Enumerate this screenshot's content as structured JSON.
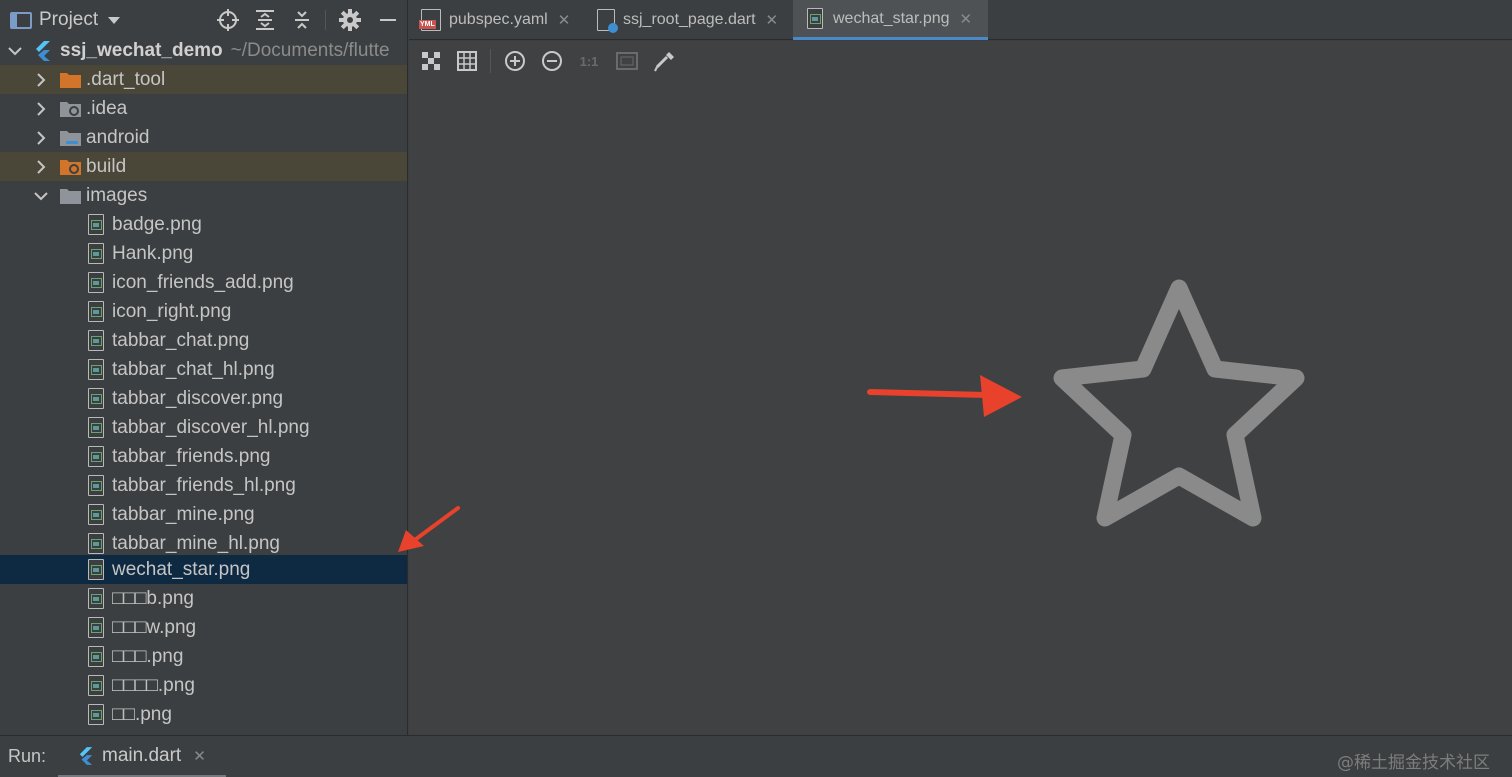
{
  "project_panel": {
    "title": "Project",
    "tools": [
      "locate-icon",
      "expand-all-icon",
      "collapse-all-icon",
      "gear-icon",
      "minimize-icon"
    ]
  },
  "tree": {
    "root": {
      "name": "ssj_wechat_demo",
      "path": "~/Documents/flutte"
    },
    "folders": [
      {
        "name": ".dart_tool",
        "expanded": false,
        "highlight": true
      },
      {
        "name": ".idea",
        "expanded": false,
        "highlight": false
      },
      {
        "name": "android",
        "expanded": false,
        "highlight": false
      },
      {
        "name": "build",
        "expanded": false,
        "highlight": true
      },
      {
        "name": "images",
        "expanded": true,
        "highlight": false
      }
    ],
    "images": [
      "badge.png",
      "Hank.png",
      "icon_friends_add.png",
      "icon_right.png",
      "tabbar_chat.png",
      "tabbar_chat_hl.png",
      "tabbar_discover.png",
      "tabbar_discover_hl.png",
      "tabbar_friends.png",
      "tabbar_friends_hl.png",
      "tabbar_mine.png",
      "tabbar_mine_hl.png",
      "wechat_star.png",
      "□□□b.png",
      "□□□w.png",
      "□□□.png",
      "□□□□.png",
      "□□.png"
    ],
    "selected": "wechat_star.png"
  },
  "tabs": [
    {
      "label": "pubspec.yaml",
      "icon": "yaml-file-icon",
      "yml_badge": "YML"
    },
    {
      "label": "ssj_root_page.dart",
      "icon": "dart-file-icon"
    },
    {
      "label": "wechat_star.png",
      "icon": "image-file-icon",
      "active": true
    }
  ],
  "image_toolbar": {
    "tools": [
      "chessboard-icon",
      "grid-icon",
      "zoom-in-icon",
      "zoom-out-icon",
      "actual-size-icon",
      "fit-zoom-icon",
      "color-picker-icon"
    ],
    "actual_size_label": "1:1"
  },
  "bottom": {
    "run_label": "Run:",
    "run_tab": "main.dart",
    "watermark": "@稀土掘金技术社区"
  },
  "colors": {
    "accent": "#4a88c7",
    "arrow": "#e8412c",
    "star": "#8a8a8a",
    "selection": "#0d2a42"
  }
}
